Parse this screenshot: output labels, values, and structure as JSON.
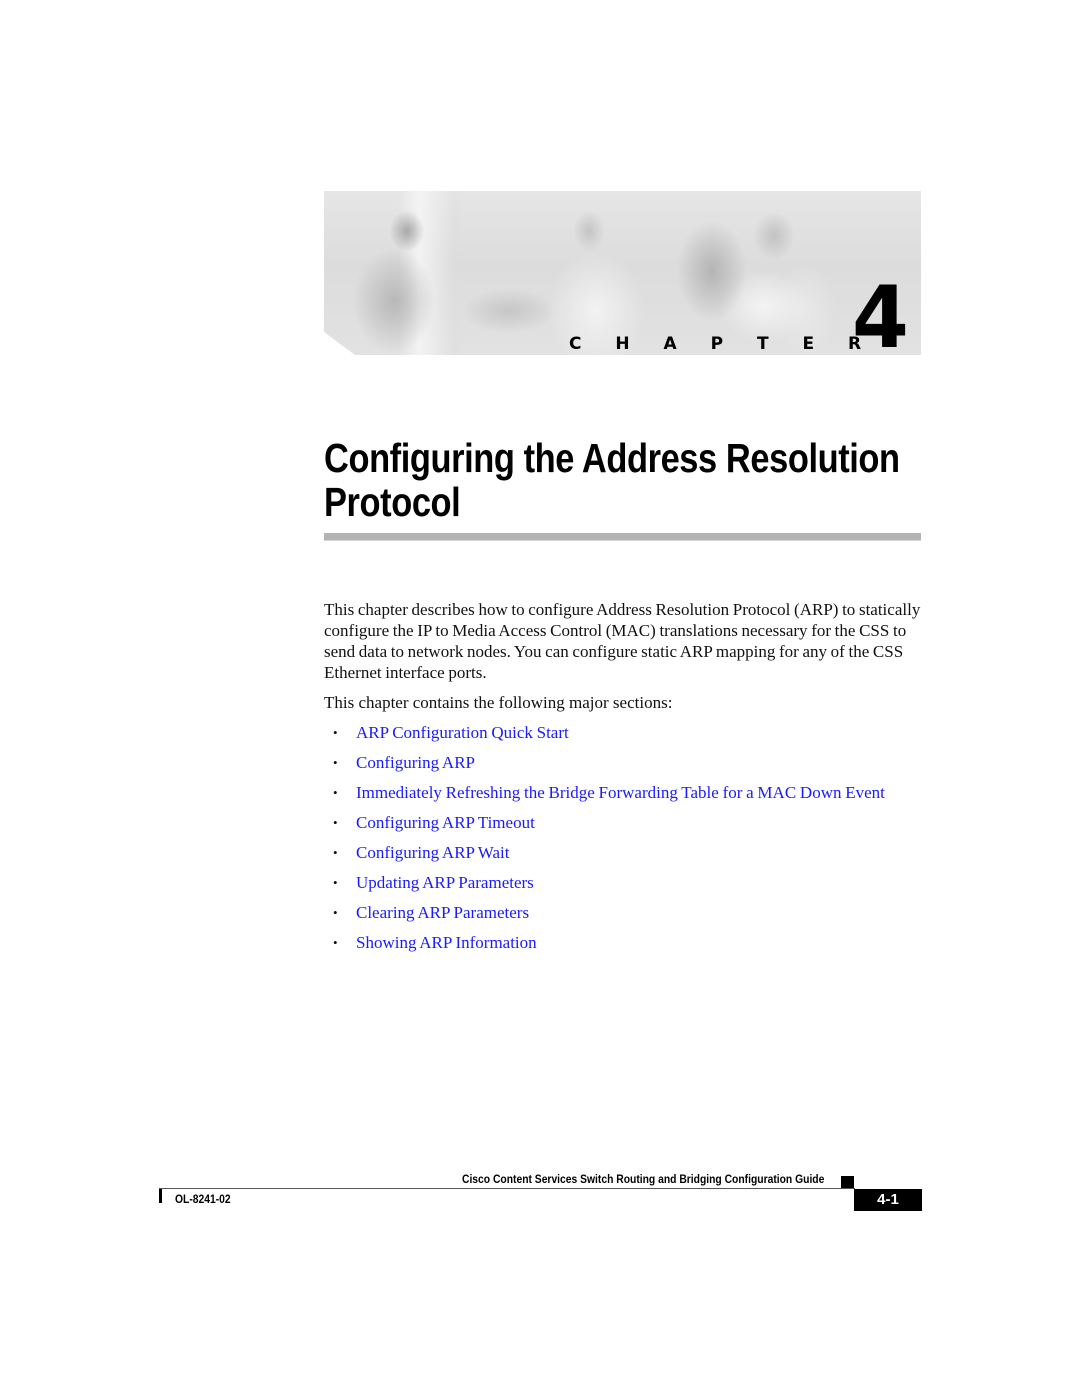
{
  "chapter": {
    "label": "C H A P T E R",
    "number": "4",
    "banner_image": "chapter-banner-photo"
  },
  "title": {
    "line1": "Configuring the Address Resolution",
    "line2": "Protocol"
  },
  "body": {
    "intro": "This chapter describes how to configure Address Resolution Protocol (ARP) to statically configure the IP to Media Access Control (MAC) translations necessary for the CSS to send data to network nodes. You can configure static ARP mapping for any of the CSS Ethernet interface ports.",
    "sections_lead": "This chapter contains the following major sections:"
  },
  "sections": [
    {
      "label": "ARP Configuration Quick Start"
    },
    {
      "label": "Configuring ARP"
    },
    {
      "label": "Immediately Refreshing the Bridge Forwarding Table for a MAC Down Event"
    },
    {
      "label": "Configuring ARP Timeout"
    },
    {
      "label": "Configuring ARP Wait"
    },
    {
      "label": "Updating ARP Parameters"
    },
    {
      "label": "Clearing ARP Parameters"
    },
    {
      "label": "Showing ARP Information"
    }
  ],
  "bullet_glyph": "•",
  "footer": {
    "guide_title": "Cisco Content Services Switch Routing and Bridging Configuration Guide",
    "doc_id": "OL-8241-02",
    "page_number": "4-1"
  },
  "colors": {
    "link": "#1a1aff",
    "rule": "#b3b3b3",
    "text": "#111111"
  }
}
